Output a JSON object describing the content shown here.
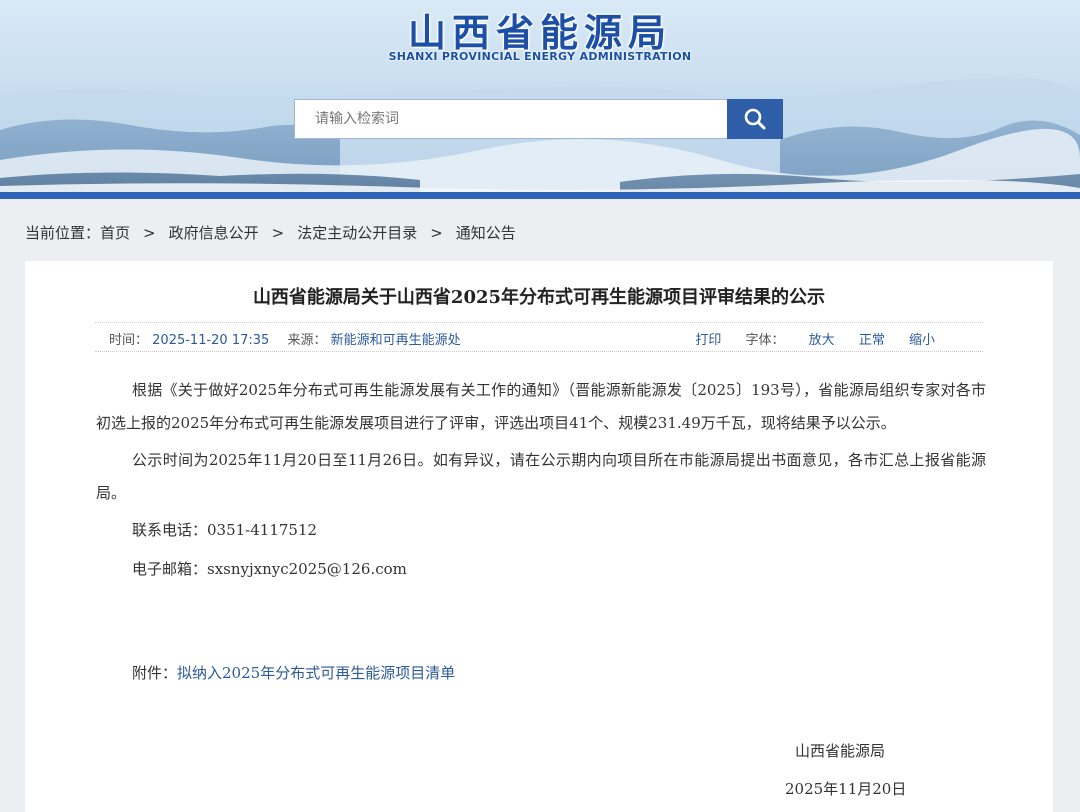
{
  "header": {
    "title_cn": "山西省能源局",
    "title_en": "SHANXI PROVINCIAL ENERGY ADMINISTRATION",
    "search_placeholder": "请输入检索词",
    "search_icon": "search-icon"
  },
  "breadcrumb": {
    "prefix": "当前位置：",
    "items": [
      "首页",
      "政府信息公开",
      "法定主动公开目录",
      "通知公告"
    ],
    "separator": ">"
  },
  "article": {
    "title": "山西省能源局关于山西省2025年分布式可再生能源项目评审结果的公示",
    "meta": {
      "time_label": "时间：",
      "time_value": "2025-11-20 17:35",
      "source_label": "来源：",
      "source_value": "新能源和可再生能源处",
      "print_label": "打印",
      "font_label": "字体：",
      "font_large": "放大",
      "font_normal": "正常",
      "font_small": "缩小"
    },
    "paragraphs": [
      "根据《关于做好2025年分布式可再生能源发展有关工作的通知》（晋能源新能源发〔2025〕193号），省能源局组织专家对各市初选上报的2025年分布式可再生能源发展项目进行了评审，评选出项目41个、规模231.49万千瓦，现将结果予以公示。",
      "公示时间为2025年11月20日至11月26日。如有异议，请在公示期内向项目所在市能源局提出书面意见，各市汇总上报省能源局。"
    ],
    "contact_phone": "联系电话：0351-4117512",
    "contact_email": "电子邮箱：sxsnyjxnyc2025@126.com",
    "attachment_label": "附件：",
    "attachment_link": "拟纳入2025年分布式可再生能源项目清单",
    "signature_org": "山西省能源局",
    "signature_date": "2025年11月20日"
  },
  "colors": {
    "brand_blue": "#1c4fa6",
    "link_blue": "#2d5a9b",
    "bar_blue": "#2f63b5"
  }
}
